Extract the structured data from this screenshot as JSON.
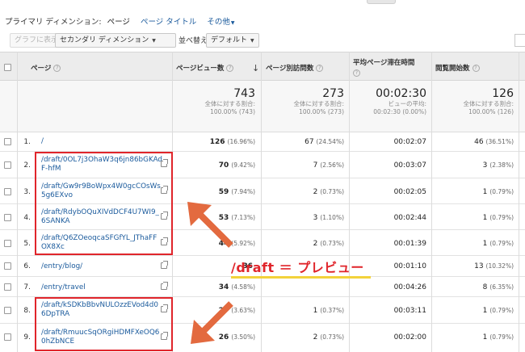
{
  "primary_dimension": {
    "label": "プライマリ ディメンション:",
    "selected": "ページ",
    "options": [
      "ページ タイトル",
      "その他"
    ]
  },
  "toolbar": {
    "graph_button": "グラフに表示",
    "secondary_dimension": "セカンダリ ディメンション",
    "sort_label": "並べ替えの種類:",
    "sort_value": "デフォルト"
  },
  "headers": {
    "page": "ページ",
    "pageviews": "ページビュー数",
    "unique_pageviews": "ページ別訪問数",
    "avg_time": "平均ページ滞在時間",
    "entrances": "閲覧開始数"
  },
  "totals": {
    "pageviews": {
      "value": "743",
      "label": "全体に対する割合:",
      "pct": "100.00% (743)"
    },
    "unique_pageviews": {
      "value": "273",
      "label": "全体に対する割合:",
      "pct": "100.00% (273)"
    },
    "avg_time": {
      "value": "00:02:30",
      "label": "ビューの平均:",
      "pct": "00:02:30 (0.00%)"
    },
    "entrances": {
      "value": "126",
      "label": "全体に対する割合:",
      "pct": "100.00% (126)"
    }
  },
  "rows": [
    {
      "n": "1.",
      "page": "/",
      "pv": "126",
      "pv_pct": "(16.96%)",
      "upv": "67",
      "upv_pct": "(24.54%)",
      "time": "00:02:07",
      "ent": "46",
      "ent_pct": "(36.51%)"
    },
    {
      "n": "2.",
      "page": "/draft/0OL7j3OhaW3q6jn86bGKAdF-hfM",
      "pv": "70",
      "pv_pct": "(9.42%)",
      "upv": "7",
      "upv_pct": "(2.56%)",
      "time": "00:03:07",
      "ent": "3",
      "ent_pct": "(2.38%)"
    },
    {
      "n": "3.",
      "page": "/draft/Gw9r9BoWpx4W0gcCOsWs5g6EXvo",
      "pv": "59",
      "pv_pct": "(7.94%)",
      "upv": "2",
      "upv_pct": "(0.73%)",
      "time": "00:02:05",
      "ent": "1",
      "ent_pct": "(0.79%)"
    },
    {
      "n": "4.",
      "page": "/draft/RdybOQuXIVdDCF4U7WI9_6SANKA",
      "pv": "53",
      "pv_pct": "(7.13%)",
      "upv": "3",
      "upv_pct": "(1.10%)",
      "time": "00:02:44",
      "ent": "1",
      "ent_pct": "(0.79%)"
    },
    {
      "n": "5.",
      "page": "/draft/Q6ZOeoqcaSFGfYL_JThaFFOX8Xc",
      "pv": "44",
      "pv_pct": "(5.92%)",
      "upv": "2",
      "upv_pct": "(0.73%)",
      "time": "00:01:39",
      "ent": "1",
      "ent_pct": "(0.79%)"
    },
    {
      "n": "6.",
      "page": "/entry/blog/",
      "pv": "36",
      "pv_pct": "",
      "upv": "",
      "upv_pct": "",
      "time": "00:01:10",
      "ent": "13",
      "ent_pct": "(10.32%)"
    },
    {
      "n": "7.",
      "page": "/entry/travel",
      "pv": "34",
      "pv_pct": "(4.58%)",
      "upv": "",
      "upv_pct": "",
      "time": "00:04:26",
      "ent": "8",
      "ent_pct": "(6.35%)"
    },
    {
      "n": "8.",
      "page": "/draft/kSDKbBbvNULOzzEVod4d06DpTRA",
      "pv": "27",
      "pv_pct": "(3.63%)",
      "upv": "1",
      "upv_pct": "(0.37%)",
      "time": "00:03:11",
      "ent": "1",
      "ent_pct": "(0.79%)"
    },
    {
      "n": "9.",
      "page": "/draft/RmuucSqORgiHDMFXeOQ60hZbNCE",
      "pv": "26",
      "pv_pct": "(3.50%)",
      "upv": "2",
      "upv_pct": "(0.73%)",
      "time": "00:02:00",
      "ent": "1",
      "ent_pct": "(0.79%)"
    }
  ],
  "annotation": {
    "text": "/draft ＝ プレビュー"
  },
  "colors": {
    "accent": "#e0252b",
    "link": "#1a5a9c",
    "highlight": "#f3d23b"
  }
}
